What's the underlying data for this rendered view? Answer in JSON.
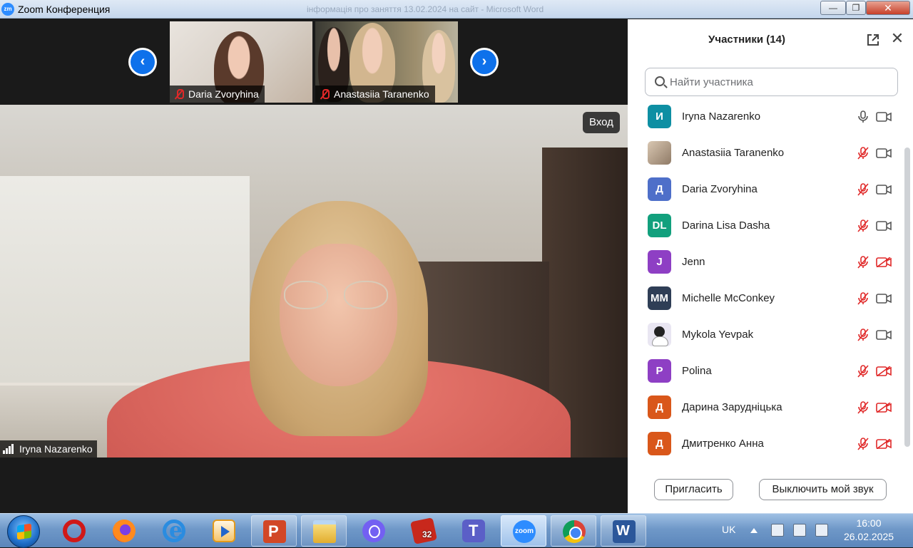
{
  "window": {
    "logo": "zm",
    "title": "Zoom Конференция",
    "background_text": "інформація про заняття 13.02.2024 на сайт - Microsoft Word",
    "minimize": "—",
    "maximize": "❐",
    "close": "✕"
  },
  "gallery": {
    "prev_icon": "‹",
    "next_icon": "›",
    "thumbnails": [
      {
        "name": "Daria Zvoryhina",
        "muted": true
      },
      {
        "name": "Anastasiia Taranenko",
        "muted": true
      }
    ]
  },
  "main_video": {
    "speaker_name": "Iryna Nazarenko",
    "tooltip": "Вход"
  },
  "participants_panel": {
    "title": "Участники (14)",
    "close_icon": "✕",
    "search_placeholder": "Найти участника",
    "participants": [
      {
        "initials": "И",
        "avatar_color": "#0e8fa3",
        "name": "Iryna Nazarenko",
        "mic": "on",
        "video": "on"
      },
      {
        "initials": "",
        "avatar_type": "photo",
        "name": "Anastasiia Taranenko",
        "mic": "muted",
        "video": "on"
      },
      {
        "initials": "Д",
        "avatar_color": "#4e6fc9",
        "name": "Daria Zvoryhina",
        "mic": "muted",
        "video": "on"
      },
      {
        "initials": "DL",
        "avatar_color": "#12a07d",
        "name": "Darina Lisa Dasha",
        "mic": "muted",
        "video": "on"
      },
      {
        "initials": "J",
        "avatar_color": "#8e3fc4",
        "name": "Jenn",
        "mic": "muted",
        "video": "off"
      },
      {
        "initials": "MM",
        "avatar_color": "#2f3e56",
        "name": "Michelle McConkey",
        "mic": "muted",
        "video": "on"
      },
      {
        "initials": "",
        "avatar_type": "cartoon",
        "name": "Mykola Yevpak",
        "mic": "muted",
        "video": "on"
      },
      {
        "initials": "P",
        "avatar_color": "#8e3fc4",
        "name": "Polina",
        "mic": "muted",
        "video": "off"
      },
      {
        "initials": "Д",
        "avatar_color": "#d9571a",
        "name": "Дарина Зарудніцька",
        "mic": "muted",
        "video": "off"
      },
      {
        "initials": "Д",
        "avatar_color": "#d9571a",
        "name": "Дмитренко Анна",
        "mic": "muted",
        "video": "off"
      }
    ],
    "invite_button": "Пригласить",
    "mute_me_button": "Выключить мой звук"
  },
  "taskbar": {
    "apps": [
      {
        "name": "opera",
        "state": "idle"
      },
      {
        "name": "firefox",
        "state": "idle"
      },
      {
        "name": "internet-explorer",
        "state": "idle"
      },
      {
        "name": "media-player",
        "state": "idle"
      },
      {
        "name": "powerpoint",
        "state": "open"
      },
      {
        "name": "file-explorer",
        "state": "open"
      },
      {
        "name": "viber",
        "state": "idle"
      },
      {
        "name": "puzzle-game",
        "state": "idle",
        "badge": "32"
      },
      {
        "name": "teams",
        "state": "idle"
      },
      {
        "name": "zoom",
        "state": "active",
        "label": "zoom"
      },
      {
        "name": "chrome",
        "state": "open"
      },
      {
        "name": "word",
        "state": "open"
      }
    ],
    "language": "UK",
    "time": "16:00",
    "date": "26.02.2025"
  },
  "colors": {
    "zoom_blue": "#0e71eb",
    "muted_red": "#e02828",
    "sweater": "#d8645c"
  }
}
